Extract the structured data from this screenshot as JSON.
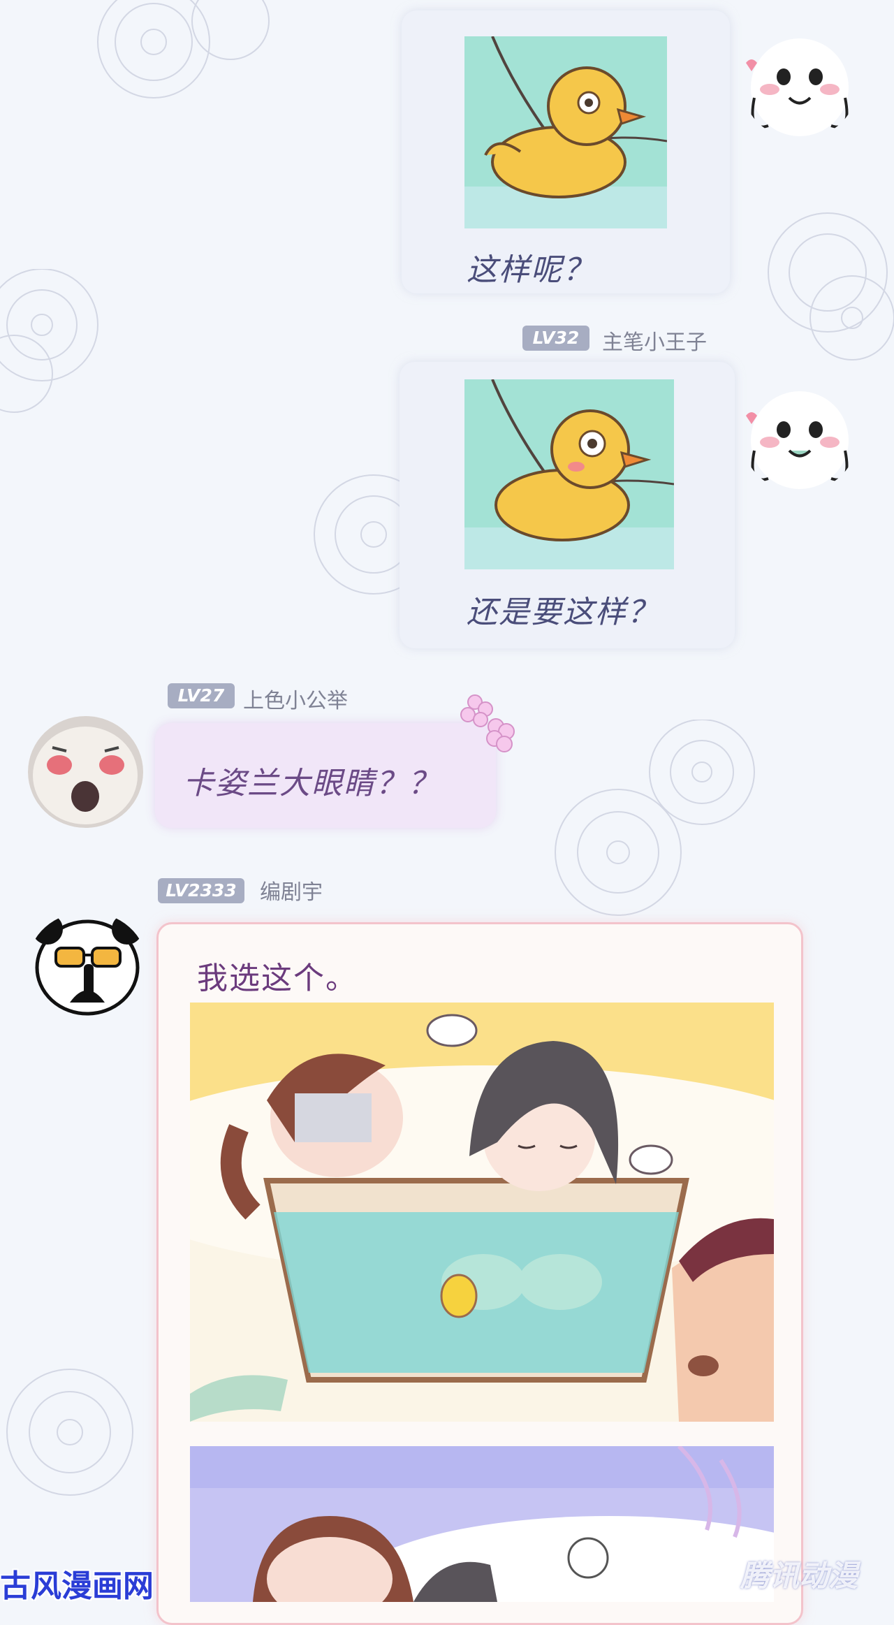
{
  "messages": [
    {
      "type": "image",
      "caption": "这样呢？",
      "side": "right",
      "avatar": "ghost-avatar"
    },
    {
      "type": "image",
      "level": "LV32",
      "username": "主笔小王子",
      "caption": "还是要这样？",
      "side": "right",
      "avatar": "ghost-avatar"
    },
    {
      "type": "text",
      "level": "LV27",
      "username": "上色小公举",
      "text": "卡姿兰大眼睛？？",
      "side": "left",
      "avatar": "cat-avatar"
    },
    {
      "type": "card",
      "level": "LV2333",
      "username": "编剧宇",
      "text": "我选这个。",
      "side": "left",
      "avatar": "panda-avatar"
    }
  ],
  "watermarks": {
    "left": "古风漫画网",
    "right": "腾讯动漫"
  },
  "colors": {
    "background": "#f3f6fb",
    "image_bubble": "#eef1f9",
    "pink_bubble": "#f1e6f8",
    "card_border": "#f3c3cb",
    "level_badge": "#a7adc2",
    "caption_text": "#4a4d7a"
  }
}
